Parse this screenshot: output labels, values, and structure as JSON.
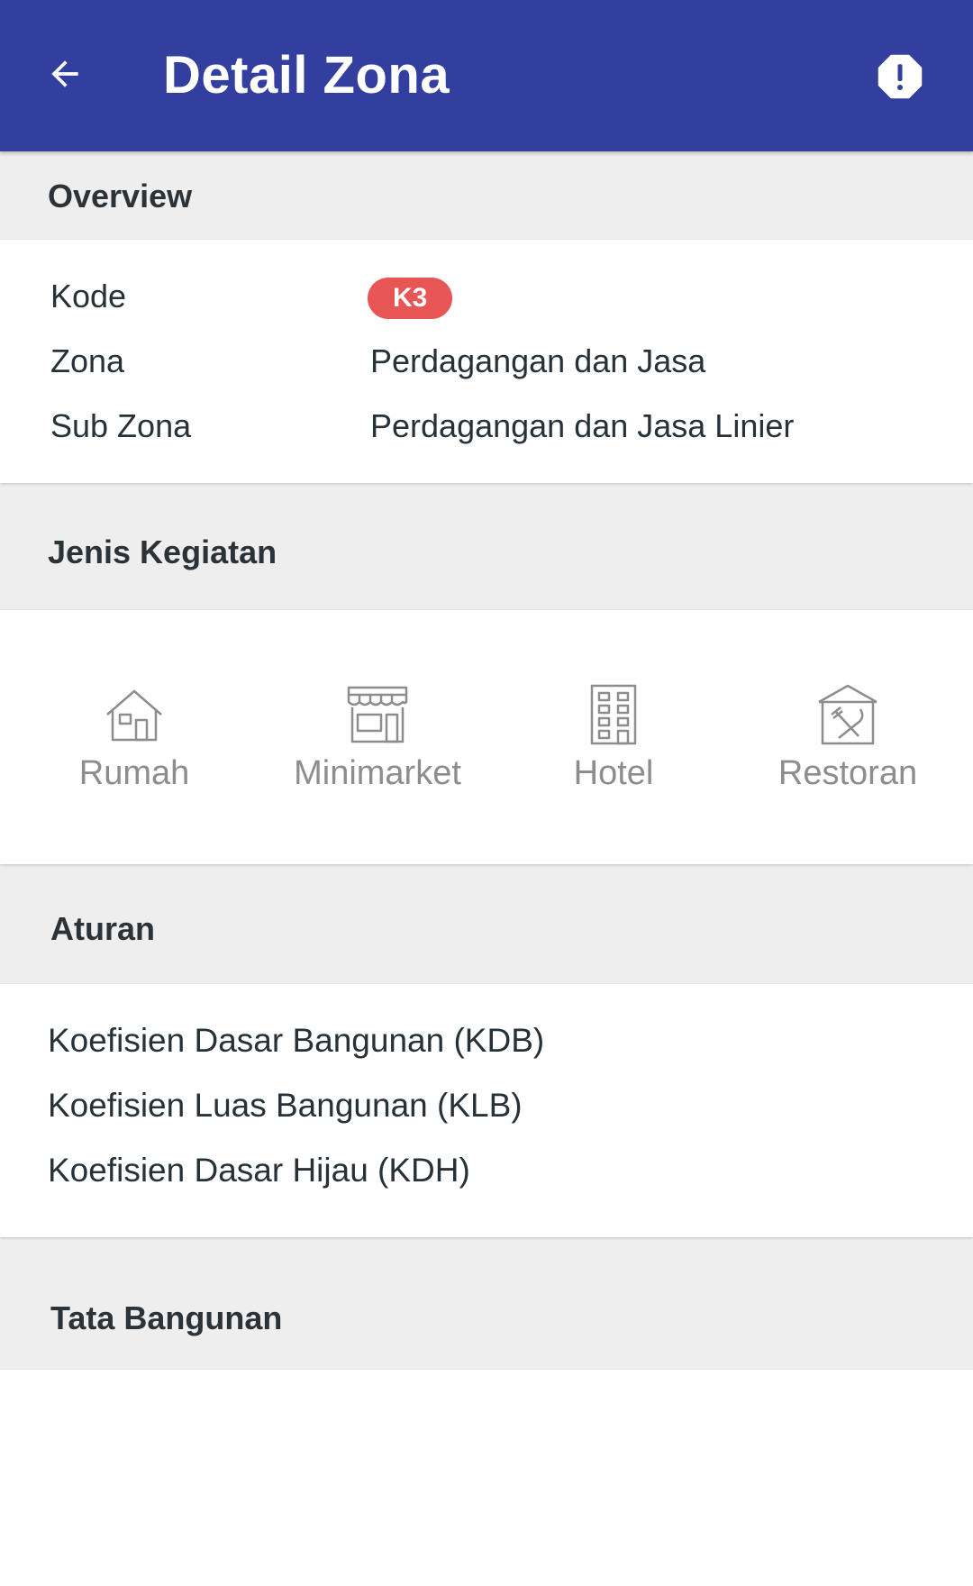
{
  "appbar": {
    "title": "Detail Zona",
    "back_icon": "arrow-left-icon",
    "report_icon": "alert-octagon-icon",
    "color": "#323f9e"
  },
  "overview": {
    "header": "Overview",
    "rows": [
      {
        "label": "Kode",
        "value": "K3"
      },
      {
        "label": "Zona",
        "value": "Perdagangan dan Jasa"
      },
      {
        "label": "Sub Zona",
        "value": "Perdagangan dan Jasa Linier"
      }
    ],
    "badge_color": "#e85555"
  },
  "activities": {
    "header": "Jenis Kegiatan",
    "items": [
      {
        "label": "Rumah",
        "icon": "house-icon"
      },
      {
        "label": "Minimarket",
        "icon": "store-icon"
      },
      {
        "label": "Hotel",
        "icon": "building-icon"
      },
      {
        "label": "Restoran",
        "icon": "restaurant-icon"
      }
    ]
  },
  "rules": {
    "header": "Aturan",
    "items": [
      "Koefisien Dasar Bangunan (KDB)",
      "Koefisien Luas Bangunan (KLB)",
      "Koefisien Dasar Hijau (KDH)"
    ]
  },
  "building": {
    "header": "Tata Bangunan"
  }
}
